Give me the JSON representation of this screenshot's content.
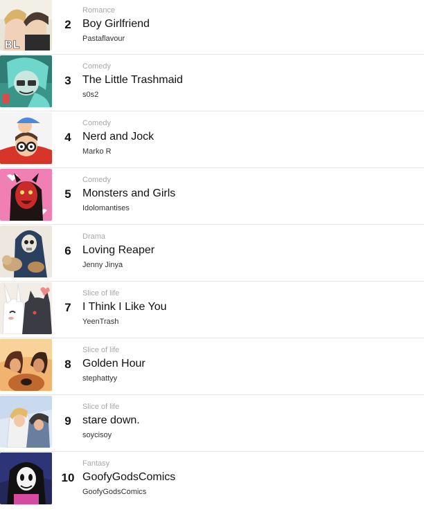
{
  "ranking": {
    "items": [
      {
        "rank": "2",
        "genre": "Romance",
        "title": "Boy Girlfriend",
        "author": "Pastaflavour",
        "thumb_badge": "BL"
      },
      {
        "rank": "3",
        "genre": "Comedy",
        "title": "The Little Trashmaid",
        "author": "s0s2"
      },
      {
        "rank": "4",
        "genre": "Comedy",
        "title": "Nerd and Jock",
        "author": "Marko R"
      },
      {
        "rank": "5",
        "genre": "Comedy",
        "title": "Monsters and Girls",
        "author": "Idolomantises"
      },
      {
        "rank": "6",
        "genre": "Drama",
        "title": "Loving Reaper",
        "author": "Jenny Jinya"
      },
      {
        "rank": "7",
        "genre": "Slice of life",
        "title": "I Think I Like You",
        "author": "YeenTrash"
      },
      {
        "rank": "8",
        "genre": "Slice of life",
        "title": "Golden Hour",
        "author": "stephattyy"
      },
      {
        "rank": "9",
        "genre": "Slice of life",
        "title": "stare down.",
        "author": "soycisoy"
      },
      {
        "rank": "10",
        "genre": "Fantasy",
        "title": "GoofyGodsComics",
        "author": "GoofyGodsComics"
      }
    ]
  },
  "colors": {
    "title": "#111111",
    "genre": "#a8a8a8",
    "author": "#333333",
    "divider": "#e6e6e6"
  }
}
